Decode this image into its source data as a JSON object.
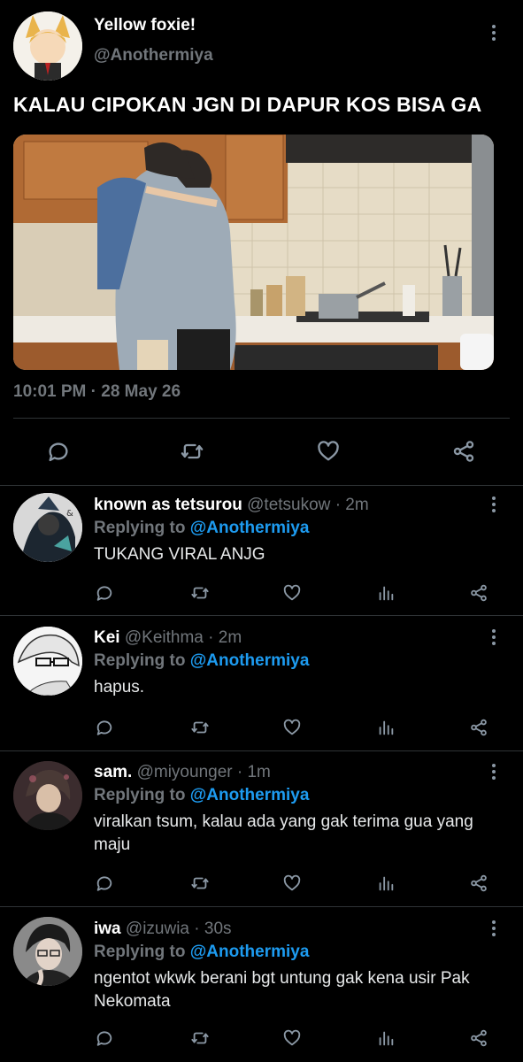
{
  "tweet": {
    "author_name": "Yellow foxie!",
    "author_handle": "@Anothermiya",
    "text": "KALAU CIPOKAN JGN DI DAPUR KOS BISA GA",
    "timestamp": "10:01 PM · 28 May 26",
    "actions": [
      "reply-icon",
      "retweet-icon",
      "like-icon",
      "share-icon"
    ]
  },
  "replies": [
    {
      "name": "known as tetsurou",
      "handle": "@tetsukow",
      "time": "· 2m",
      "replying_prefix": "Replying to",
      "replying_to": "@Anothermiya",
      "text": "TUKANG VIRAL ANJG"
    },
    {
      "name": "Kei",
      "handle": "@Keithma",
      "time": "· 2m",
      "replying_prefix": "Replying to",
      "replying_to": "@Anothermiya",
      "text": "hapus."
    },
    {
      "name": "sam.",
      "handle": "@miyounger",
      "time": "· 1m",
      "replying_prefix": "Replying to",
      "replying_to": "@Anothermiya",
      "text": "viralkan tsum, kalau ada yang gak terima gua yang maju"
    },
    {
      "name": "iwa",
      "handle": "@izuwia",
      "time": "· 30s",
      "replying_prefix": "Replying to",
      "replying_to": "@Anothermiya",
      "text": "ngentot wkwk berani bgt untung gak kena usir Pak Nekomata"
    }
  ],
  "colors": {
    "background": "#000000",
    "muted": "#71767b",
    "link": "#1d9bf0",
    "divider": "#2f3336"
  }
}
